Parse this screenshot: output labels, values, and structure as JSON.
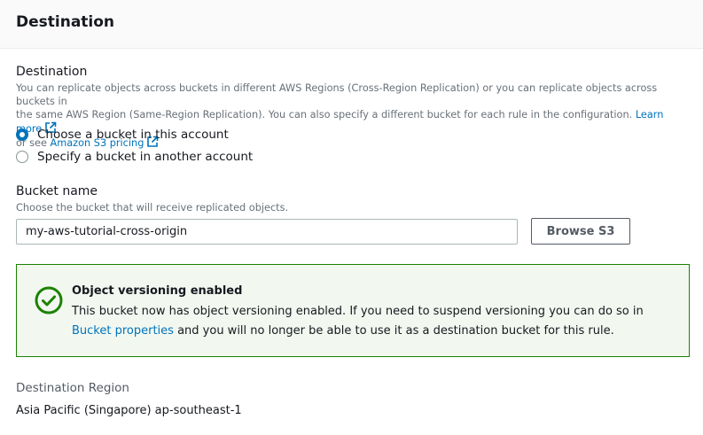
{
  "header": {
    "title": "Destination"
  },
  "destination": {
    "label": "Destination",
    "description_line1": "You can replicate objects across buckets in different AWS Regions (Cross-Region Replication) or you can replicate objects across buckets in",
    "description_line2": "the same AWS Region (Same-Region Replication). You can also specify a different bucket for each rule in the configuration.",
    "learn_more": "Learn more",
    "description_line3": "or see",
    "pricing_link": "Amazon S3 pricing",
    "options": [
      {
        "label": "Choose a bucket in this account",
        "selected": true
      },
      {
        "label": "Specify a bucket in another account",
        "selected": false
      }
    ]
  },
  "bucket": {
    "label": "Bucket name",
    "description": "Choose the bucket that will receive replicated objects.",
    "value": "my-aws-tutorial-cross-origin",
    "browse_label": "Browse S3"
  },
  "alert": {
    "title": "Object versioning enabled",
    "body_part1": "This bucket now has object versioning enabled. If you need to suspend versioning you can do so in",
    "link": "Bucket properties",
    "body_part2": "and you will no longer be able to use it as a destination bucket for this rule.",
    "icon": "check-circle-icon",
    "color": "#1d8102"
  },
  "region": {
    "label": "Destination Region",
    "value": "Asia Pacific (Singapore) ap-southeast-1"
  }
}
